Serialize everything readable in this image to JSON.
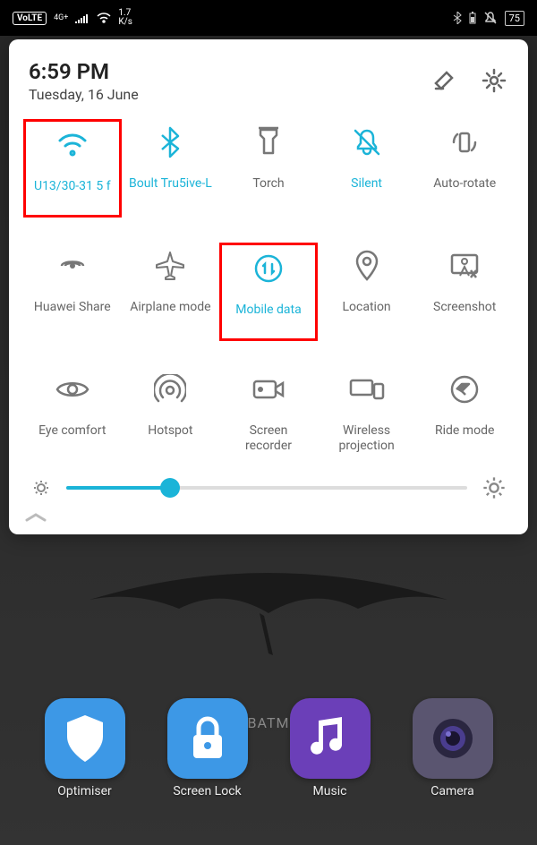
{
  "statusbar": {
    "volte": "VoLTE",
    "net_type": "4G+",
    "data_speed_value": "1.7",
    "data_speed_unit": "K/s",
    "battery_pct": "75"
  },
  "panel": {
    "time": "6:59 PM",
    "date": "Tuesday, 16 June"
  },
  "tiles": [
    {
      "label": "U13/30-31 5 f",
      "active": true,
      "highlight": true,
      "icon": "wifi"
    },
    {
      "label": "Boult Tru5ive-L",
      "active": true,
      "highlight": false,
      "icon": "bluetooth"
    },
    {
      "label": "Torch",
      "active": false,
      "highlight": false,
      "icon": "torch"
    },
    {
      "label": "Silent",
      "active": true,
      "highlight": false,
      "icon": "silent"
    },
    {
      "label": "Auto-rotate",
      "active": false,
      "highlight": false,
      "icon": "rotate"
    },
    {
      "label": "Huawei Share",
      "active": false,
      "highlight": false,
      "icon": "share"
    },
    {
      "label": "Airplane mode",
      "active": false,
      "highlight": false,
      "icon": "airplane"
    },
    {
      "label": "Mobile data",
      "active": true,
      "highlight": true,
      "icon": "mobiledata"
    },
    {
      "label": "Location",
      "active": false,
      "highlight": false,
      "icon": "location"
    },
    {
      "label": "Screenshot",
      "active": false,
      "highlight": false,
      "icon": "screenshot"
    },
    {
      "label": "Eye comfort",
      "active": false,
      "highlight": false,
      "icon": "eye"
    },
    {
      "label": "Hotspot",
      "active": false,
      "highlight": false,
      "icon": "hotspot"
    },
    {
      "label": "Screen\nrecorder",
      "active": false,
      "highlight": false,
      "icon": "recorder"
    },
    {
      "label": "Wireless\nprojection",
      "active": false,
      "highlight": false,
      "icon": "projection"
    },
    {
      "label": "Ride mode",
      "active": false,
      "highlight": false,
      "icon": "ride"
    }
  ],
  "brightness": {
    "percent": 26
  },
  "apps": [
    {
      "label": "Optimiser",
      "color": "#3d98e6",
      "icon": "shield"
    },
    {
      "label": "Screen Lock",
      "color": "#3d98e6",
      "icon": "lock"
    },
    {
      "label": "Music",
      "color": "#6b3fb8",
      "icon": "music"
    },
    {
      "label": "Camera",
      "color": "#5a5570",
      "icon": "camera"
    }
  ],
  "wallpaper_text": "BATM"
}
